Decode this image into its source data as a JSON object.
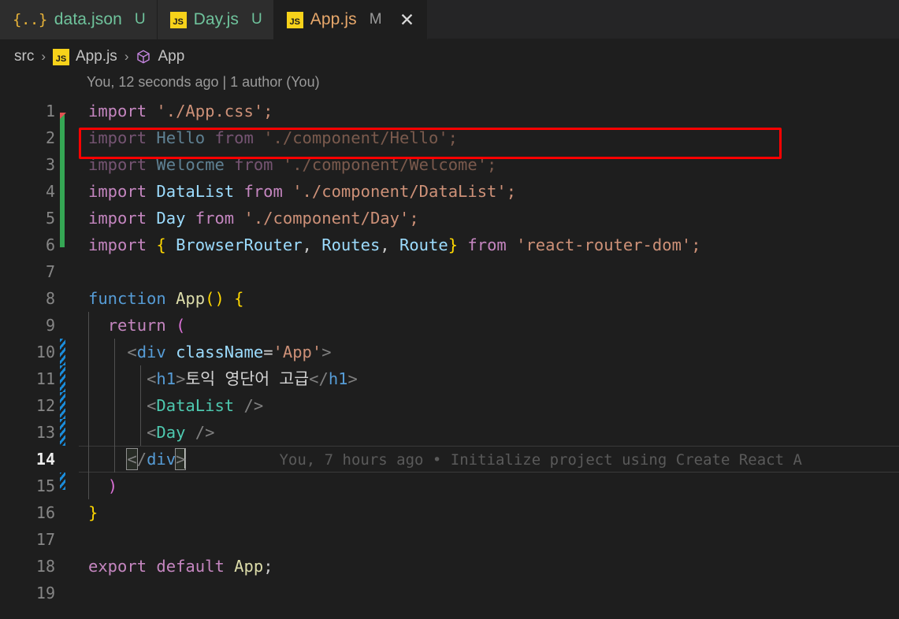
{
  "window": {
    "app": "Visual Studio Code",
    "theme_bg": "#1E1E1E",
    "tabbar_bg": "#252526",
    "accent_red": "#FF0000"
  },
  "tabs": [
    {
      "label": "data.json",
      "state": "U",
      "icon": "json-braces-icon",
      "icon_text": "{..}",
      "active": false,
      "closable": false
    },
    {
      "label": "Day.js",
      "state": "U",
      "icon": "js-file-icon",
      "icon_text": "JS",
      "active": false,
      "closable": false
    },
    {
      "label": "App.js",
      "state": "M",
      "icon": "js-file-icon",
      "icon_text": "JS",
      "active": true,
      "closable": true,
      "close_glyph": "✕"
    }
  ],
  "breadcrumb": {
    "items": [
      {
        "label": "src",
        "icon": null
      },
      {
        "label": "App.js",
        "icon": "js-file-icon",
        "icon_text": "JS"
      },
      {
        "label": "App",
        "icon": "symbol-class-cube-icon"
      }
    ],
    "separator": "›"
  },
  "blame_header": "You, 12 seconds ago | 1 author (You)",
  "inline_blame": {
    "line": 14,
    "text": "You, 7 hours ago • Initialize project using Create React A"
  },
  "annotation": {
    "type": "red-rectangle-highlight",
    "target_line": 6,
    "color": "#FF0000"
  },
  "editor": {
    "file": "App.js",
    "language": "javascriptreact",
    "cursor_line": 14,
    "lines": [
      {
        "n": "1",
        "gutter": "added-start",
        "indent": 0,
        "text": "import './App.css';"
      },
      {
        "n": "2",
        "gutter": "added",
        "indent": 0,
        "dimmed": true,
        "text": "import Hello from './component/Hello';"
      },
      {
        "n": "3",
        "gutter": "added",
        "indent": 0,
        "dimmed": true,
        "text": "import Welocme from './component/Welcome';"
      },
      {
        "n": "4",
        "gutter": "added",
        "indent": 0,
        "text": "import DataList from './component/DataList';"
      },
      {
        "n": "5",
        "gutter": "added",
        "indent": 0,
        "text": "import Day from './component/Day';"
      },
      {
        "n": "6",
        "gutter": "added",
        "indent": 0,
        "text": "import { BrowserRouter, Routes, Route} from 'react-router-dom';"
      },
      {
        "n": "7",
        "gutter": "none",
        "indent": 0,
        "text": ""
      },
      {
        "n": "8",
        "gutter": "none",
        "indent": 0,
        "text": "function App() {"
      },
      {
        "n": "9",
        "gutter": "none",
        "indent": 1,
        "text": "  return ("
      },
      {
        "n": "10",
        "gutter": "striped",
        "indent": 2,
        "text": "    <div className='App'>"
      },
      {
        "n": "11",
        "gutter": "striped",
        "indent": 3,
        "text": "      <h1>토익 영단어 고급</h1>"
      },
      {
        "n": "12",
        "gutter": "striped",
        "indent": 3,
        "text": "      <DataList />"
      },
      {
        "n": "13",
        "gutter": "striped",
        "indent": 3,
        "text": "      <Day />"
      },
      {
        "n": "14",
        "gutter": "none",
        "indent": 2,
        "text": "    </div>"
      },
      {
        "n": "15",
        "gutter": "striped",
        "indent": 1,
        "text": "  )"
      },
      {
        "n": "16",
        "gutter": "none",
        "indent": 0,
        "text": "}"
      },
      {
        "n": "17",
        "gutter": "none",
        "indent": 0,
        "text": ""
      },
      {
        "n": "18",
        "gutter": "none",
        "indent": 0,
        "text": "export default App;"
      },
      {
        "n": "19",
        "gutter": "none",
        "indent": 0,
        "text": ""
      }
    ]
  },
  "tokens": {
    "t_import": "import",
    "t_from": "from",
    "t_function": "function",
    "t_return": "return",
    "t_export": "export",
    "t_default": "default",
    "s_appcss": "'./App.css';",
    "s_hello": "'./component/Hello';",
    "s_welcome": "'./component/Welcome';",
    "s_datalist": "'./component/DataList';",
    "s_day": "'./component/Day';",
    "s_router": "'react-router-dom';",
    "i_Hello": "Hello",
    "i_Welocme": "Welocme",
    "i_DataList": "DataList",
    "i_Day": "Day",
    "i_BrowserRouter": "BrowserRouter",
    "i_Routes": "Routes",
    "i_Route": "Route",
    "i_App": "App",
    "h1_text": "토익 영단어 고급",
    "cls_App": "'App'",
    "attr_className": "className"
  }
}
